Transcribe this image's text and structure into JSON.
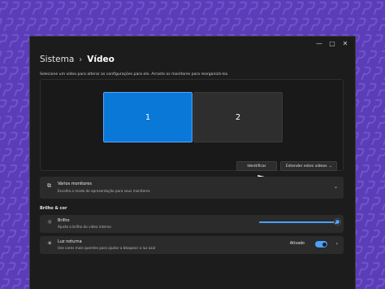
{
  "colors": {
    "background": "#5b3db8",
    "accent": "#0a78d6",
    "slider": "#4aa0ff"
  },
  "window": {
    "controls": {
      "minimize_icon": "minimize-icon",
      "maximize_icon": "maximize-icon",
      "close_icon": "close-icon"
    }
  },
  "breadcrumb": {
    "parent": "Sistema",
    "separator": "›",
    "current": "Vídeo"
  },
  "instruction": "Selecione um vídeo para alterar as configurações para ele. Arraste os monitores para reorganizá-los.",
  "monitors": [
    {
      "label": "1",
      "selected": true
    },
    {
      "label": "2",
      "selected": false
    }
  ],
  "buttons": {
    "identify": "Identificar",
    "extend": "Estender estes vídeos"
  },
  "multiple_monitors": {
    "title": "Vários monitores",
    "description": "Escolha o modo de apresentação para seus monitores"
  },
  "brightness_section": {
    "title": "Brilho & cor"
  },
  "brightness": {
    "title": "Brilho",
    "description": "Ajuste o brilho do vídeo interno",
    "value_percent": 100
  },
  "night_light": {
    "title": "Luz noturna",
    "description": "Use cores mais quentes para ajudar a bloquear a luz azul",
    "status": "Ativado",
    "enabled": true
  }
}
